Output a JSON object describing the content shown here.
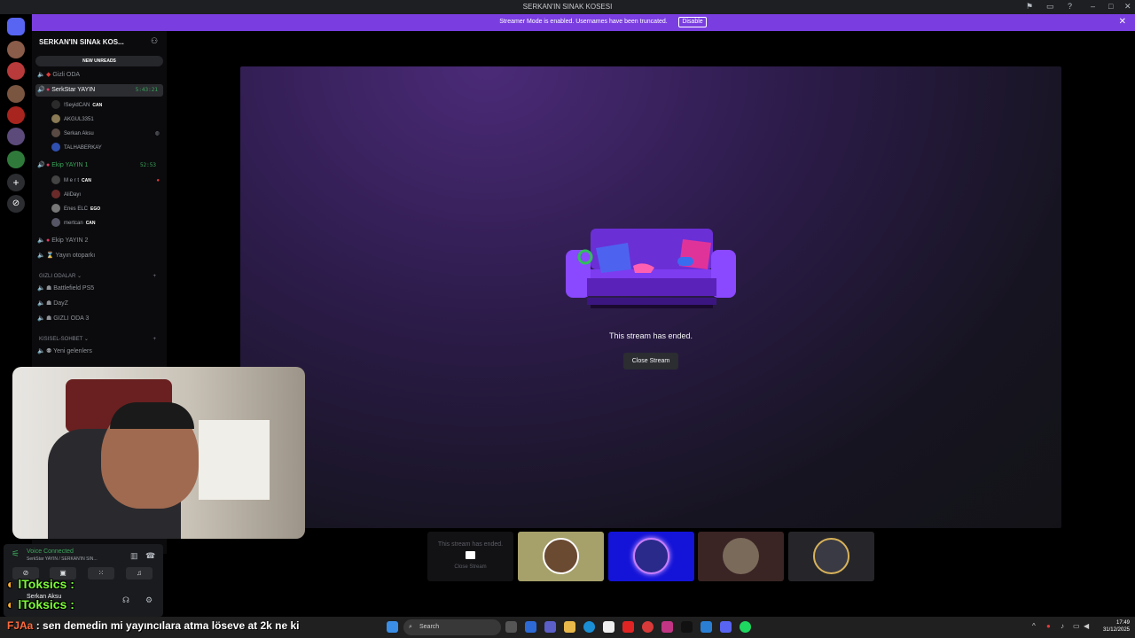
{
  "window": {
    "title": "SERKAN'IN SINAK KOSESI"
  },
  "banner": {
    "message": "Streamer Mode is enabled. Usernames have been truncated.",
    "disable_label": "Disable"
  },
  "sidebar": {
    "server_name": "SERKAN'IN SINAk KOS...",
    "new_unreads": "NEW UNREADS",
    "channels": [
      {
        "name": "Gizli ODA"
      },
      {
        "name": "SerkStar YAYIN",
        "timer": "5:43:21"
      },
      {
        "name": "Ekip YAYIN 1",
        "timer": "52:53"
      },
      {
        "name": "Ekip YAYIN 2"
      },
      {
        "name": "Yayın otoparkı"
      }
    ],
    "users_serkstar": [
      {
        "name": "!SeyidCAN",
        "badge": "CAN"
      },
      {
        "name": "AKGUL3351"
      },
      {
        "name": "Serkan Aksu"
      },
      {
        "name": "TALHABERKAY"
      }
    ],
    "users_ekip": [
      {
        "name": "M e r t",
        "badge": "CAN"
      },
      {
        "name": "AliDayı"
      },
      {
        "name": "Enes ELC",
        "badge": "EGO"
      },
      {
        "name": "mertcan",
        "badge": "CAN"
      }
    ],
    "category_gizli": "GIZLI ODALAR",
    "gizli_channels": [
      "Battlefield PS5",
      "DayZ",
      "GIZLI ODA 3"
    ],
    "category_kisisel": "KISISEL-SOHBET",
    "kisisel_channels": [
      "Yeni gelenlers"
    ]
  },
  "stream": {
    "ended_text": "This stream has ended.",
    "close_label": "Close Stream"
  },
  "participants": {
    "ended_tile_text": "This stream has ended.",
    "ended_tile_button": "Close Stream"
  },
  "voice": {
    "status": "Voice Connected",
    "channel": "SerkStar YAYIN / SERKAN'IN SIN...",
    "user": "Serkan Aksu"
  },
  "chat": {
    "line1": "lToksics :",
    "line2": "lToksics :",
    "author": "FJAa",
    "message": ": sen demedin mi yayıncılara atma löseve at 2k ne ki"
  },
  "taskbar": {
    "search_placeholder": "Search",
    "time": "17:49",
    "date": "31/12/2025"
  },
  "colors": {
    "accent": "#7a3ee0",
    "voice_green": "#3ba55c",
    "chat_green": "#7dfc3a"
  }
}
